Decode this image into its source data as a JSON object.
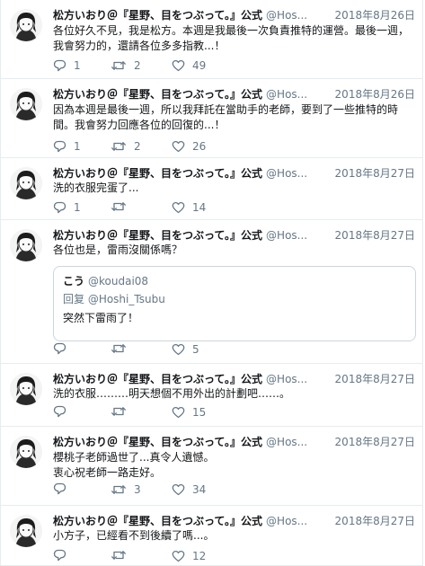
{
  "colors": {
    "icon": "#657786",
    "text": "#14171a",
    "border": "#e6ecf0"
  },
  "icons": {
    "avatar": "avatar-illustration",
    "reply": "reply-bubble-icon",
    "retweet": "retweet-arrows-icon",
    "like": "heart-icon"
  },
  "tweets": [
    {
      "name": "松方いおり＠『星野、目をつぶって。』公式",
      "handle": "@Hos...",
      "date": "2018年8月26日",
      "lines": [
        "各位好久不見，我是松方。本週是我最後一次負責推特的運營。最後一週，",
        "我會努力的，還請各位多多指教...！"
      ],
      "replies": "1",
      "retweets": "2",
      "likes": "49"
    },
    {
      "name": "松方いおり＠『星野、目をつぶって。』公式",
      "handle": "@Hos...",
      "date": "2018年8月26日",
      "lines": [
        "因為本週是最後一週，所以我拜託在當助手的老師，要到了一些推特的時",
        "間。我會努力回應各位的回復的...！"
      ],
      "replies": "1",
      "retweets": "2",
      "likes": "26"
    },
    {
      "name": "松方いおり＠『星野、目をつぶって。』公式",
      "handle": "@Hos...",
      "date": "2018年8月27日",
      "lines": [
        "洗的衣服完蛋了..."
      ],
      "replies": "1",
      "retweets": "",
      "likes": "14"
    },
    {
      "name": "松方いおり＠『星野、目をつぶって。』公式",
      "handle": "@Hos...",
      "date": "2018年8月27日",
      "lines": [
        "各位也是，雷雨沒關係嗎？"
      ],
      "quote": {
        "name": "こう",
        "handle": "@koudai08",
        "reply_to": "回复 @Hoshi_Tsubu",
        "text": "突然下雷雨了！"
      },
      "replies": "",
      "retweets": "",
      "likes": "5"
    },
    {
      "name": "松方いおり＠『星野、目をつぶって。』公式",
      "handle": "@Hos...",
      "date": "2018年8月27日",
      "lines": [
        "洗的衣服………明天想個不用外出的計劃吧……。"
      ],
      "replies": "",
      "retweets": "",
      "likes": "15"
    },
    {
      "name": "松方いおり＠『星野、目をつぶって。』公式",
      "handle": "@Hos...",
      "date": "2018年8月27日",
      "lines": [
        "櫻桃子老師過世了...真令人遺憾。",
        "衷心祝老師一路走好。"
      ],
      "replies": "",
      "retweets": "3",
      "likes": "34"
    },
    {
      "name": "松方いおり＠『星野、目をつぶって。』公式",
      "handle": "@Hos...",
      "date": "2018年8月27日",
      "lines": [
        "小方子，已經看不到後續了嗎...。"
      ],
      "replies": "",
      "retweets": "",
      "likes": "12"
    }
  ]
}
